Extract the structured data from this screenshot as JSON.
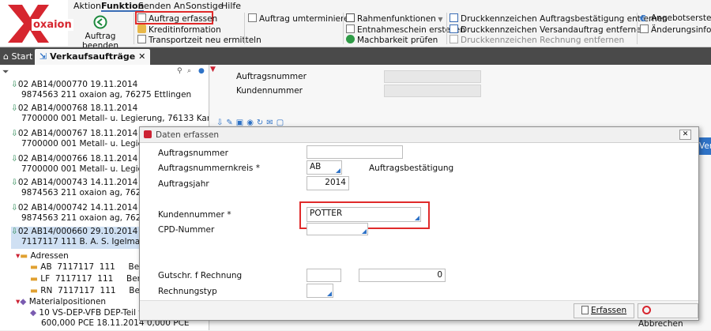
{
  "brand": {
    "logo_text": "oxaion"
  },
  "menu": [
    "Aktion",
    "Funktion",
    "Senden An",
    "Sonstige",
    "Hilfe"
  ],
  "ribbon": {
    "auftrag_beenden": "Auftrag beenden",
    "auftrag_erfassen": "Auftrag erfassen",
    "kreditinformation": "Kreditinformation",
    "transportzeit": "Transportzeit neu ermitteln",
    "auftrag_umterminieren": "Auftrag umterminieren",
    "rahmenfunktionen": "Rahmenfunktionen",
    "entnahmeschein": "Entnahmeschein erstellen",
    "machbarkeit": "Machbarkeit prüfen",
    "druck1": "Druckkennzeichen Auftragsbestätigung entfernen",
    "druck2": "Druckkennzeichen Versandauftrag entfernen",
    "druck3": "Druckkennzeichen Rechnung entfernen",
    "angebot1": "Angebotserstellu",
    "angebot2": "Änderungsinform"
  },
  "tabs": {
    "start": "Start",
    "verkauf": "Verkaufsaufträge"
  },
  "tree": [
    {
      "l1": "02 AB14/000770 19.11.2014",
      "l2": "9874563 211 oxaion ag, 76275 Ettlingen"
    },
    {
      "l1": "02 AB14/000768 18.11.2014",
      "l2": "7700000 001 Metall- u. Legierung, 76133 Karlsr"
    },
    {
      "l1": "02 AB14/000767 18.11.2014",
      "l2": "7700000 001 Metall- u. Legierun"
    },
    {
      "l1": "02 AB14/000766 18.11.2014",
      "l2": "7700000 001 Metall- u. Legierun"
    },
    {
      "l1": "02 AB14/000743 14.11.2014",
      "l2": "9874563 211 oxaion ag, 76275"
    },
    {
      "l1": "02 AB14/000742 14.11.2014",
      "l2": "9874563 211 oxaion ag, 76275"
    },
    {
      "l1": "02 AB14/000660 29.10.2014",
      "l2": "7117117 111 B. A. S. Igelmann,"
    }
  ],
  "tree_sub": {
    "adressen": "Adressen",
    "ab": "AB  7117117  111     Bernd",
    "lf": "LF  7117117  111     Bernd",
    "rn": "RN  7117117  111     Bernd",
    "materialpositionen": "Materialpositionen",
    "pos1": "10 VS-DEP-VFB DEP-Teil fü",
    "pos2": "600,000 PCE 18.11.2014 0,000 PCE"
  },
  "right": {
    "auftragsnummer": "Auftragsnummer",
    "kundennummer": "Kundennummer",
    "edge": "Ver"
  },
  "dialog": {
    "title": "Daten erfassen",
    "auftragsnummer": "Auftragsnummer",
    "kreis_label": "Auftragsnummernkreis *",
    "kreis_value": "AB",
    "kreis_desc": "Auftragsbestätigung",
    "jahr_label": "Auftragsjahr",
    "jahr_value": "2014",
    "kunden_label": "Kundennummer *",
    "kunden_value": "POTTER",
    "cpd_label": "CPD-Nummer",
    "gutschr_label": "Gutschr. f Rechnung",
    "gutschr_value": "0",
    "rtyp_label": "Rechnungstyp",
    "erfassen": "Erfassen",
    "abbrechen": "Abbrechen"
  },
  "colors": {
    "accent": "#2f73c7",
    "highlight": "#e02a2a",
    "tabbar": "#4a4a4a",
    "logo_red": "#d6262f"
  }
}
